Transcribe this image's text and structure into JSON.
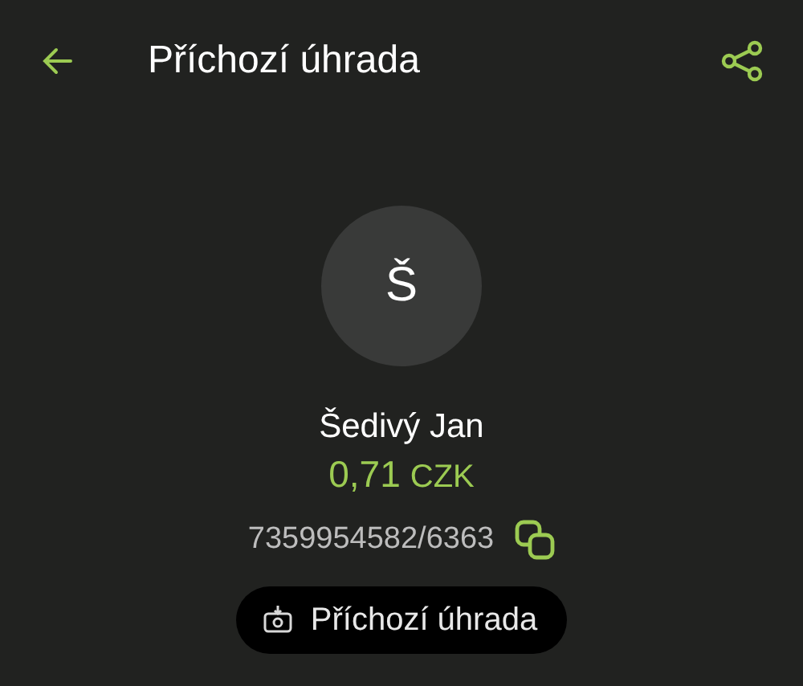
{
  "header": {
    "title": "Příchozí úhrada"
  },
  "avatar": {
    "initial": "Š"
  },
  "counterparty": {
    "name": "Šedivý Jan"
  },
  "amount": {
    "value": "0,71",
    "currency": "CZK"
  },
  "account": {
    "number": "7359954582/6363"
  },
  "type_chip": {
    "label": "Příchozí úhrada"
  }
}
